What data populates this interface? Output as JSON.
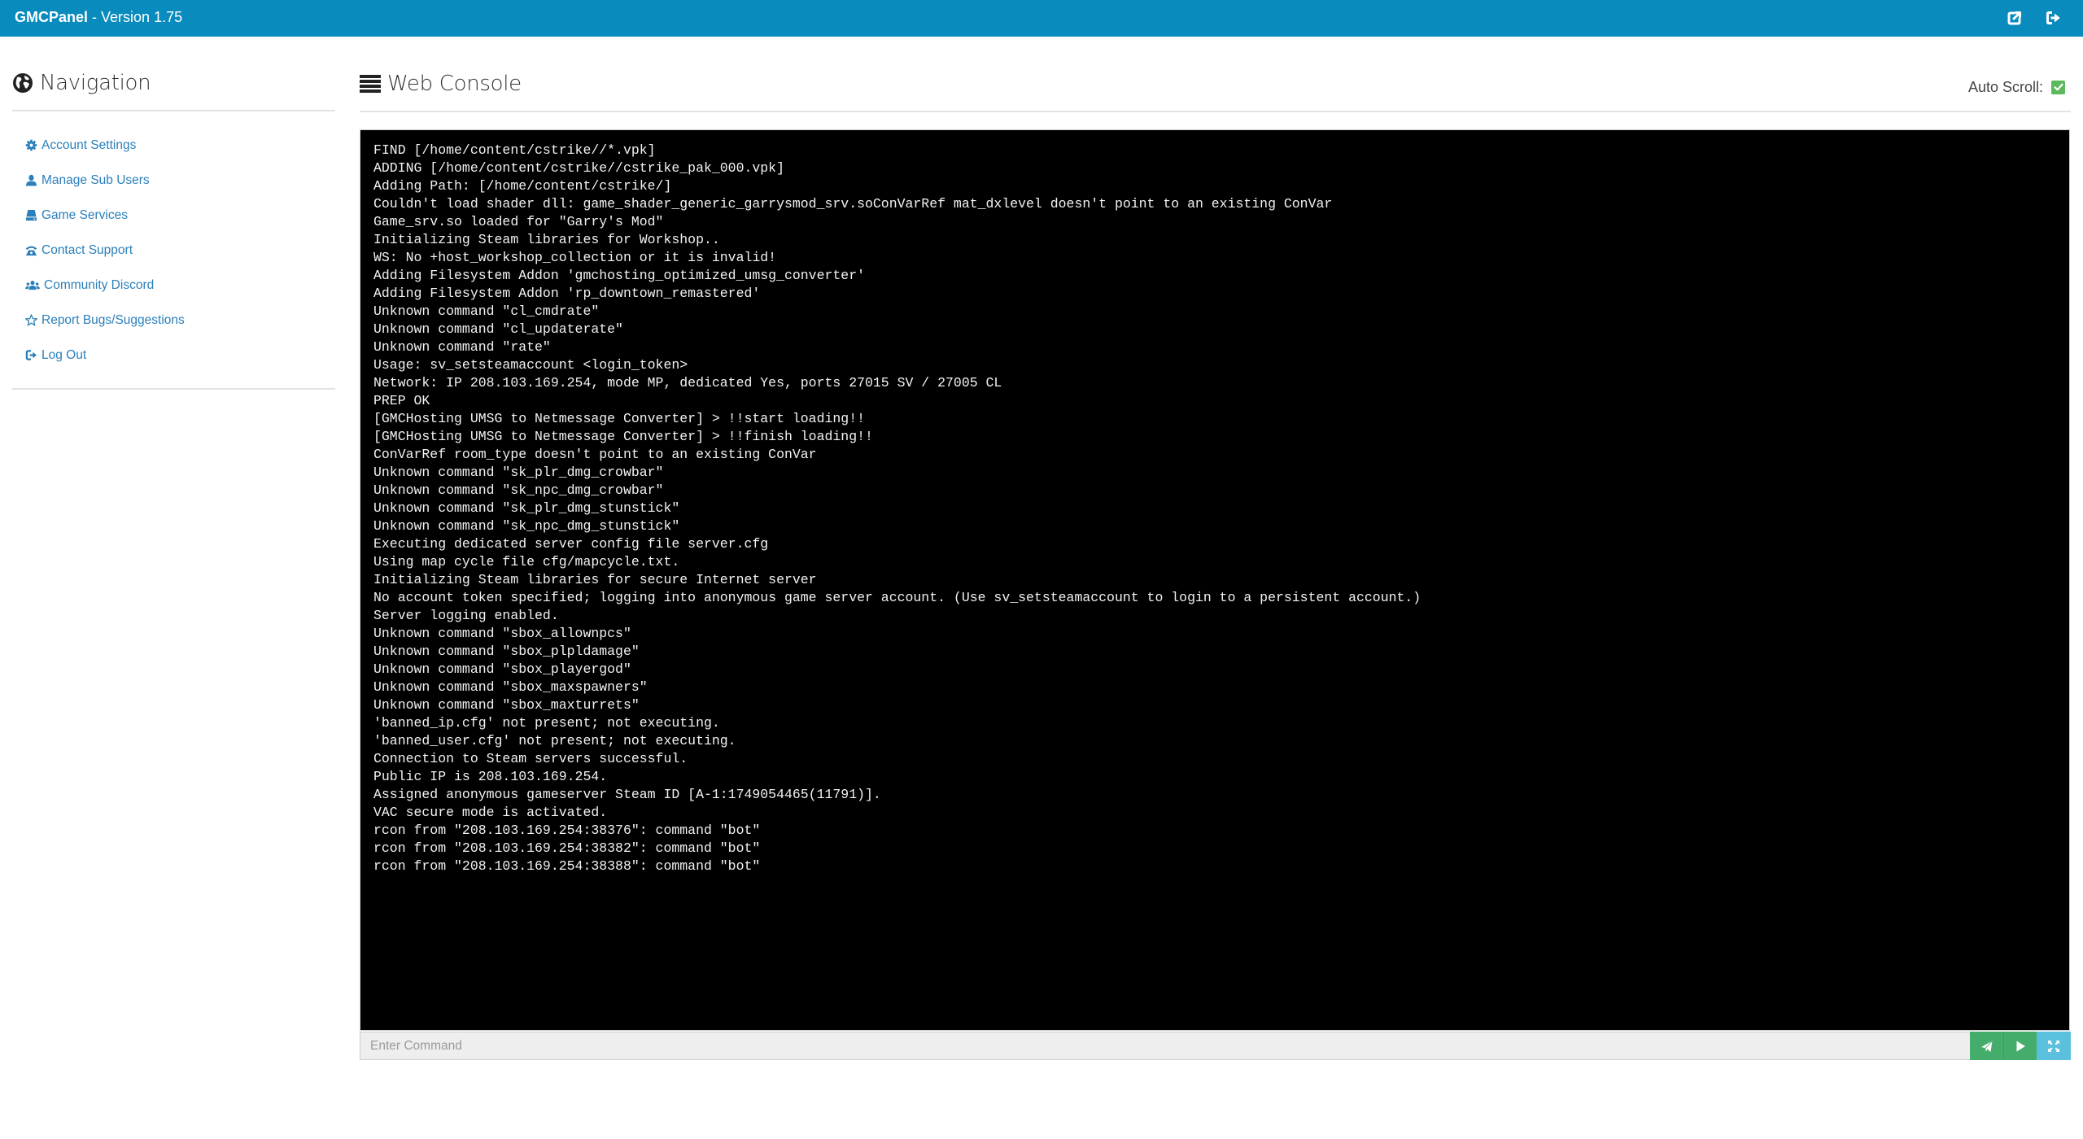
{
  "topbar": {
    "brand_name": "GMCPanel",
    "brand_version": " - Version 1.75",
    "icons": [
      "external-link-icon",
      "sign-out-icon"
    ]
  },
  "sidebar": {
    "heading": "Navigation",
    "heading_icon": "globe-icon",
    "items": [
      {
        "label": "Account Settings",
        "icon": "gear-icon"
      },
      {
        "label": "Manage Sub Users",
        "icon": "user-icon"
      },
      {
        "label": "Game Services",
        "icon": "hdd-icon"
      },
      {
        "label": "Contact Support",
        "icon": "phone-icon"
      },
      {
        "label": "Community Discord",
        "icon": "users-icon"
      },
      {
        "label": "Report Bugs/Suggestions",
        "icon": "star-icon"
      },
      {
        "label": "Log Out",
        "icon": "sign-out-icon"
      }
    ]
  },
  "console": {
    "heading": "Web Console",
    "heading_icon": "list-icon",
    "auto_scroll_label": "Auto Scroll:",
    "auto_scroll_checked": true,
    "lines": [
      "FIND [/home/content/cstrike//*.vpk]",
      "ADDING [/home/content/cstrike//cstrike_pak_000.vpk]",
      "Adding Path: [/home/content/cstrike/]",
      "Couldn't load shader dll: game_shader_generic_garrysmod_srv.soConVarRef mat_dxlevel doesn't point to an existing ConVar",
      "Game_srv.so loaded for \"Garry's Mod\"",
      "Initializing Steam libraries for Workshop..",
      "WS: No +host_workshop_collection or it is invalid!",
      "Adding Filesystem Addon 'gmchosting_optimized_umsg_converter'",
      "Adding Filesystem Addon 'rp_downtown_remastered'",
      "Unknown command \"cl_cmdrate\"",
      "Unknown command \"cl_updaterate\"",
      "Unknown command \"rate\"",
      "Usage: sv_setsteamaccount <login_token>",
      "Network: IP 208.103.169.254, mode MP, dedicated Yes, ports 27015 SV / 27005 CL",
      "PREP OK",
      "[GMCHosting UMSG to Netmessage Converter] > !!start loading!!",
      "[GMCHosting UMSG to Netmessage Converter] > !!finish loading!!",
      "ConVarRef room_type doesn't point to an existing ConVar",
      "Unknown command \"sk_plr_dmg_crowbar\"",
      "Unknown command \"sk_npc_dmg_crowbar\"",
      "Unknown command \"sk_plr_dmg_stunstick\"",
      "Unknown command \"sk_npc_dmg_stunstick\"",
      "Executing dedicated server config file server.cfg",
      "Using map cycle file cfg/mapcycle.txt.",
      "Initializing Steam libraries for secure Internet server",
      "No account token specified; logging into anonymous game server account. (Use sv_setsteamaccount to login to a persistent account.)",
      "Server logging enabled.",
      "Unknown command \"sbox_allownpcs\"",
      "Unknown command \"sbox_plpldamage\"",
      "Unknown command \"sbox_playergod\"",
      "Unknown command \"sbox_maxspawners\"",
      "Unknown command \"sbox_maxturrets\"",
      "'banned_ip.cfg' not present; not executing.",
      "'banned_user.cfg' not present; not executing.",
      "Connection to Steam servers successful.",
      "Public IP is 208.103.169.254.",
      "Assigned anonymous gameserver Steam ID [A-1:1749054465(11791)].",
      "VAC secure mode is activated.",
      "rcon from \"208.103.169.254:38376\": command \"bot\"",
      "rcon from \"208.103.169.254:38382\": command \"bot\"",
      "rcon from \"208.103.169.254:38388\": command \"bot\""
    ],
    "command_input": {
      "value": "",
      "placeholder": "Enter Command"
    },
    "buttons": [
      {
        "name": "send-button",
        "icon": "paper-plane-icon"
      },
      {
        "name": "run-button",
        "icon": "play-icon"
      },
      {
        "name": "fullscreen-button",
        "icon": "expand-icon"
      }
    ]
  },
  "colors": {
    "topbar": "#0a8bbd",
    "link": "#2b7fba",
    "console_bg": "#000000",
    "console_text": "#f2f2f2",
    "success": "#45ad6b",
    "info": "#5bc0de",
    "checkbox": "#5cb85c"
  }
}
